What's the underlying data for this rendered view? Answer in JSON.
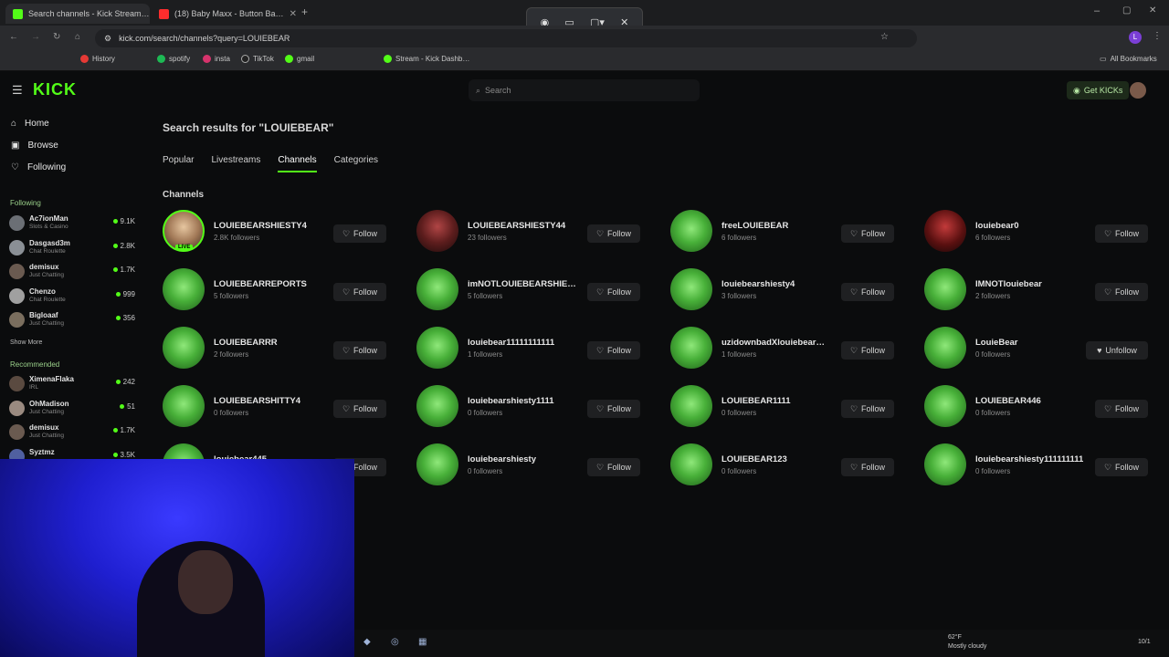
{
  "browser": {
    "tabs": [
      {
        "title": "Search channels - Kick Stream…",
        "color": "#53fc18"
      },
      {
        "title": "(18) Baby Maxx - Button Ba…",
        "color": "#ff2d2d"
      }
    ],
    "url": "kick.com/search/channels?query=LOUIEBEAR",
    "bookmarks": [
      "History",
      "spotify",
      "insta",
      "TikTok",
      "gmail",
      "Stream - Kick Dashb…"
    ],
    "all_bookmarks": "All Bookmarks"
  },
  "kick": {
    "logo": "KICK",
    "search_placeholder": "Search",
    "get_kicks": "Get KICKs",
    "nav": [
      "Home",
      "Browse",
      "Following"
    ],
    "following_title": "Following",
    "following": [
      {
        "name": "Ac7ionMan",
        "cat": "Slots & Casino",
        "viewers": "9.1K",
        "color": "#6b6f75"
      },
      {
        "name": "Dasgasd3m",
        "cat": "Chat Roulette",
        "viewers": "2.8K",
        "color": "#8a8f95"
      },
      {
        "name": "demisux",
        "cat": "Just Chatting",
        "viewers": "1.7K",
        "color": "#6a5a50"
      },
      {
        "name": "Chenzo",
        "cat": "Chat Roulette",
        "viewers": "999",
        "color": "#a0a0a0"
      },
      {
        "name": "Bigloaaf",
        "cat": "Just Chatting",
        "viewers": "356",
        "color": "#7a6e5e"
      }
    ],
    "show_more": "Show More",
    "recommended_title": "Recommended",
    "recommended": [
      {
        "name": "XimenaFlaka",
        "cat": "IRL",
        "viewers": "242",
        "color": "#5a4a40"
      },
      {
        "name": "OhMadison",
        "cat": "Just Chatting",
        "viewers": "51",
        "color": "#9a8a80"
      },
      {
        "name": "demisux",
        "cat": "Just Chatting",
        "viewers": "1.7K",
        "color": "#6a5a50"
      },
      {
        "name": "Syztmz",
        "cat": "",
        "viewers": "3.5K",
        "color": "#5060a0"
      }
    ],
    "heading": "Search results for \"LOUIEBEAR\"",
    "tabs": [
      "Popular",
      "Livestreams",
      "Channels",
      "Categories"
    ],
    "section": "Channels",
    "live_badge": "LIVE",
    "follow_label": "Follow",
    "unfollow_label": "Unfollow",
    "channels": [
      {
        "name": "LOUIEBEARSHIESTY4",
        "followers": "2.8K followers"
      },
      {
        "name": "LOUIEBEARSHIESTY44",
        "followers": "23 followers"
      },
      {
        "name": "freeLOUIEBEAR",
        "followers": "6 followers"
      },
      {
        "name": "louiebear0",
        "followers": "6 followers"
      },
      {
        "name": "LOUIEBEARREPORTS",
        "followers": "5 followers"
      },
      {
        "name": "imNOTLOUIEBEARSHIE…",
        "followers": "5 followers"
      },
      {
        "name": "louiebearshiesty4",
        "followers": "3 followers"
      },
      {
        "name": "IMNOTlouiebear",
        "followers": "2 followers"
      },
      {
        "name": "LOUIEBEARRR",
        "followers": "2 followers"
      },
      {
        "name": "louiebear11111111111",
        "followers": "1 followers"
      },
      {
        "name": "uzidownbadXlouiebear…",
        "followers": "1 followers"
      },
      {
        "name": "LouieBear",
        "followers": "0 followers"
      },
      {
        "name": "LOUIEBEARSHITTY4",
        "followers": "0 followers"
      },
      {
        "name": "louiebearshiesty1111",
        "followers": "0 followers"
      },
      {
        "name": "LOUIEBEAR1111",
        "followers": "0 followers"
      },
      {
        "name": "LOUIEBEAR446",
        "followers": "0 followers"
      },
      {
        "name": "louiebear445",
        "followers": ""
      },
      {
        "name": "louiebearshiesty",
        "followers": "0 followers"
      },
      {
        "name": "LOUIEBEAR123",
        "followers": "0 followers"
      },
      {
        "name": "louiebearshiesty111111111",
        "followers": "0 followers"
      }
    ]
  },
  "taskbar": {
    "temp": "62°F",
    "weather": "Mostly cloudy",
    "date": "10/1"
  }
}
